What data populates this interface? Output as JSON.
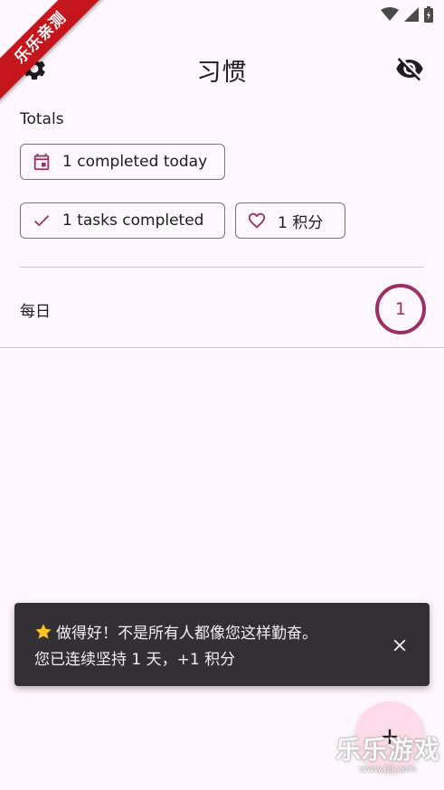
{
  "watermark": {
    "corner_ribbon": "乐乐亲测",
    "bottom_main": "乐乐游戏",
    "bottom_url": "www.6ll.com"
  },
  "status_bar": {
    "icons": [
      "wifi-icon",
      "signal-icon",
      "battery-icon"
    ]
  },
  "app_bar": {
    "title": "习惯",
    "left_icon": "settings-icon",
    "right_icon": "visibility-off-icon"
  },
  "totals": {
    "label": "Totals",
    "today": {
      "icon": "calendar-icon",
      "text": "1 completed today"
    },
    "tasks": {
      "icon": "check-icon",
      "text": "1 tasks completed"
    },
    "points": {
      "icon": "heart-icon",
      "text": "1 积分"
    }
  },
  "habits": [
    {
      "name": "每日",
      "count": "1"
    }
  ],
  "snackbar": {
    "icon": "star-icon",
    "line1": "做得好！不是所有人都像您这样勤奋。",
    "line2": "您已连续坚持 1 天，+1 积分",
    "close_icon": "close-icon"
  },
  "fab": {
    "icon": "plus-icon"
  },
  "colors": {
    "background": "#fef7fd",
    "accent": "#9c2f63",
    "snackbar_bg": "#322f35",
    "fab_bg": "#fddbe8",
    "ribbon": "#c4161c"
  }
}
